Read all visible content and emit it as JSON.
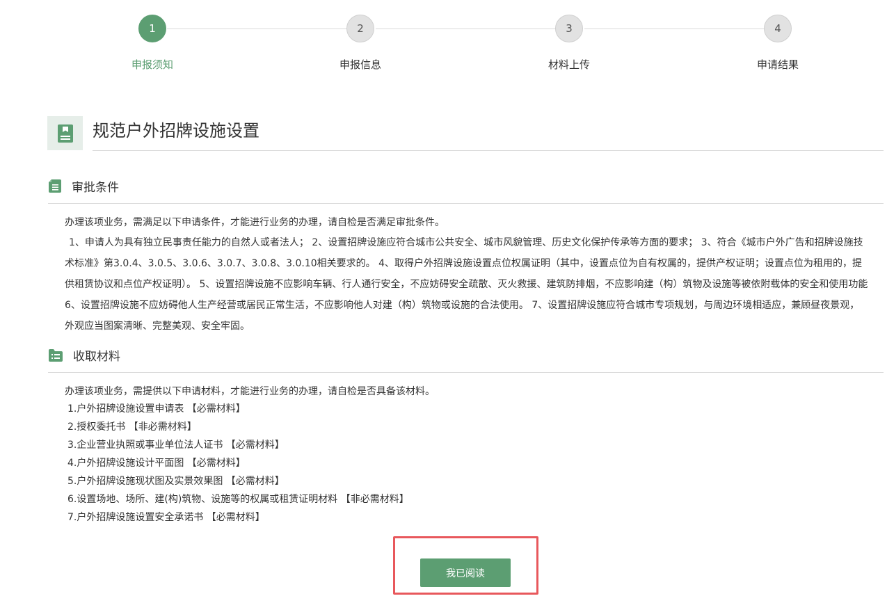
{
  "stepper": {
    "steps": [
      {
        "number": "1",
        "label": "申报须知"
      },
      {
        "number": "2",
        "label": "申报信息"
      },
      {
        "number": "3",
        "label": "材料上传"
      },
      {
        "number": "4",
        "label": "申请结果"
      }
    ],
    "active_index": 0
  },
  "header": {
    "title": "规范户外招牌设施设置",
    "icon": "document-icon"
  },
  "conditions": {
    "heading": "审批条件",
    "icon": "file-list-icon",
    "intro": "办理该项业务，需满足以下申请条件，才能进行业务的办理，请自检是否满足审批条件。",
    "text": "1、申请人为具有独立民事责任能力的自然人或者法人； 2、设置招牌设施应符合城市公共安全、城市风貌管理、历史文化保护传承等方面的要求； 3、符合《城市户外广告和招牌设施技术标准》第3.0.4、3.0.5、3.0.6、3.0.7、3.0.8、3.0.10相关要求的。 4、取得户外招牌设施设置点位权属证明（其中，设置点位为自有权属的，提供产权证明；设置点位为租用的，提供租赁协议和点位产权证明）。 5、设置招牌设施不应影响车辆、行人通行安全，不应妨碍安全疏散、灭火救援、建筑防排烟，不应影响建（构）筑物及设施等被依附载体的安全和使用功能 6、设置招牌设施不应妨碍他人生产经营或居民正常生活，不应影响他人对建（构）筑物或设施的合法使用。 7、设置招牌设施应符合城市专项规划，与周边环境相适应，兼顾昼夜景观，外观应当图案清晰、完整美观、安全牢固。"
  },
  "materials": {
    "heading": "收取材料",
    "icon": "folder-list-icon",
    "intro": "办理该项业务，需提供以下申请材料，才能进行业务的办理，请自检是否具备该材料。",
    "items": [
      "1.户外招牌设施设置申请表 【必需材料】",
      "2.授权委托书 【非必需材料】",
      "3.企业营业执照或事业单位法人证书 【必需材料】",
      "4.户外招牌设施设计平面图 【必需材料】",
      "5.户外招牌设施现状图及实景效果图 【必需材料】",
      "6.设置场地、场所、建(构)筑物、设施等的权属或租赁证明材料 【非必需材料】",
      "7.户外招牌设施设置安全承诺书 【必需材料】"
    ]
  },
  "actions": {
    "confirm_label": "我已阅读"
  },
  "colors": {
    "accent": "#5c9e72",
    "highlight": "#e8585c"
  }
}
